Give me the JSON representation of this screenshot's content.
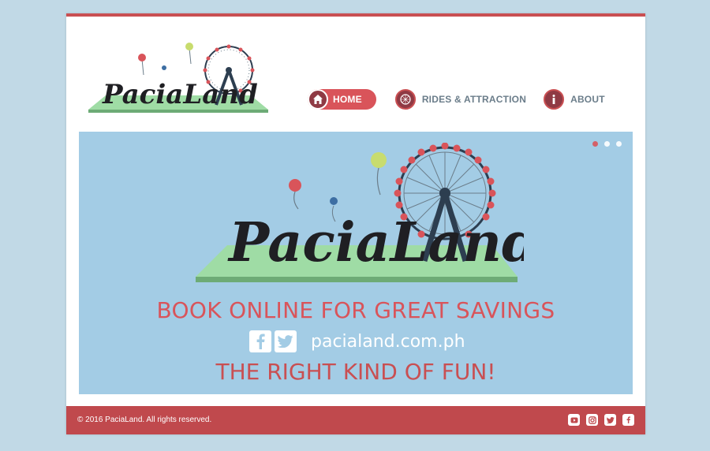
{
  "brand": {
    "name": "PaciaLand",
    "colors": {
      "accent": "#d9545a",
      "dark_red": "#8f3a44",
      "sky": "#a3cce5",
      "grass": "#9fdca5",
      "navy": "#2d3e50"
    }
  },
  "nav": {
    "items": [
      {
        "label": "HOME",
        "icon": "home-icon",
        "active": true
      },
      {
        "label": "RIDES & ATTRACTION",
        "icon": "ferris-wheel-icon",
        "active": false
      },
      {
        "label": "ABOUT",
        "icon": "info-icon",
        "active": false
      }
    ]
  },
  "banner": {
    "slide_count": 3,
    "active_slide": 1,
    "headline": "BOOK ONLINE FOR GREAT SAVINGS",
    "url": "pacialand.com.ph",
    "slogan": "THE RIGHT KIND OF FUN!"
  },
  "footer": {
    "copyright": "© 2016 PaciaLand. All rights reserved.",
    "social": [
      "youtube-icon",
      "instagram-icon",
      "twitter-icon",
      "facebook-icon"
    ]
  }
}
